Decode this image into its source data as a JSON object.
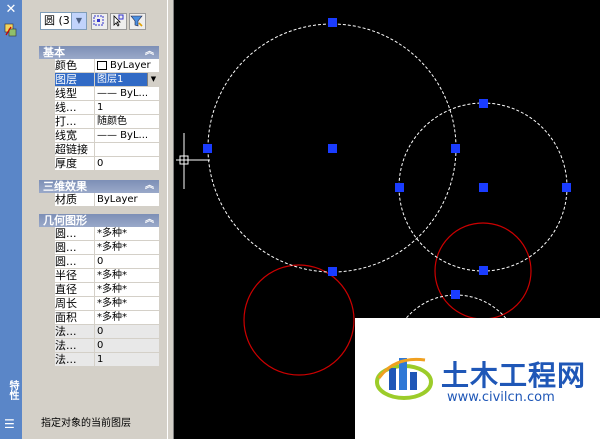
{
  "object_selector": {
    "value": "圆 (3"
  },
  "sections": {
    "basic": "基本",
    "three_d": "三维效果",
    "geometry": "几何图形"
  },
  "basic_rows": [
    {
      "label": "颜色",
      "value": "ByLayer"
    },
    {
      "label": "图层",
      "value": "图层1"
    },
    {
      "label": "线型",
      "value": "—— ByL..."
    },
    {
      "label": "线...",
      "value": "1"
    },
    {
      "label": "打...",
      "value": "随颜色"
    },
    {
      "label": "线宽",
      "value": "—— ByL..."
    },
    {
      "label": "超链接",
      "value": ""
    },
    {
      "label": "厚度",
      "value": "0"
    }
  ],
  "three_d_rows": [
    {
      "label": "材质",
      "value": "ByLayer"
    }
  ],
  "geometry_rows": [
    {
      "label": "圆...",
      "value": "*多种*"
    },
    {
      "label": "圆...",
      "value": "*多种*"
    },
    {
      "label": "圆...",
      "value": "0"
    },
    {
      "label": "半径",
      "value": "*多种*"
    },
    {
      "label": "直径",
      "value": "*多种*"
    },
    {
      "label": "周长",
      "value": "*多种*"
    },
    {
      "label": "面积",
      "value": "*多种*"
    },
    {
      "label": "法...",
      "value": "0"
    },
    {
      "label": "法...",
      "value": "0"
    },
    {
      "label": "法...",
      "value": "1"
    }
  ],
  "status_text": "指定对象的当前图层",
  "palette_title": "特性",
  "watermark": {
    "brand": "土木工程网",
    "url": "www.civilcn.com"
  },
  "colors": {
    "grip": "#1a3cff",
    "selected_circle": "#ffffff",
    "red_circle": "#cc0000",
    "title_bar": "#5a86c8"
  }
}
